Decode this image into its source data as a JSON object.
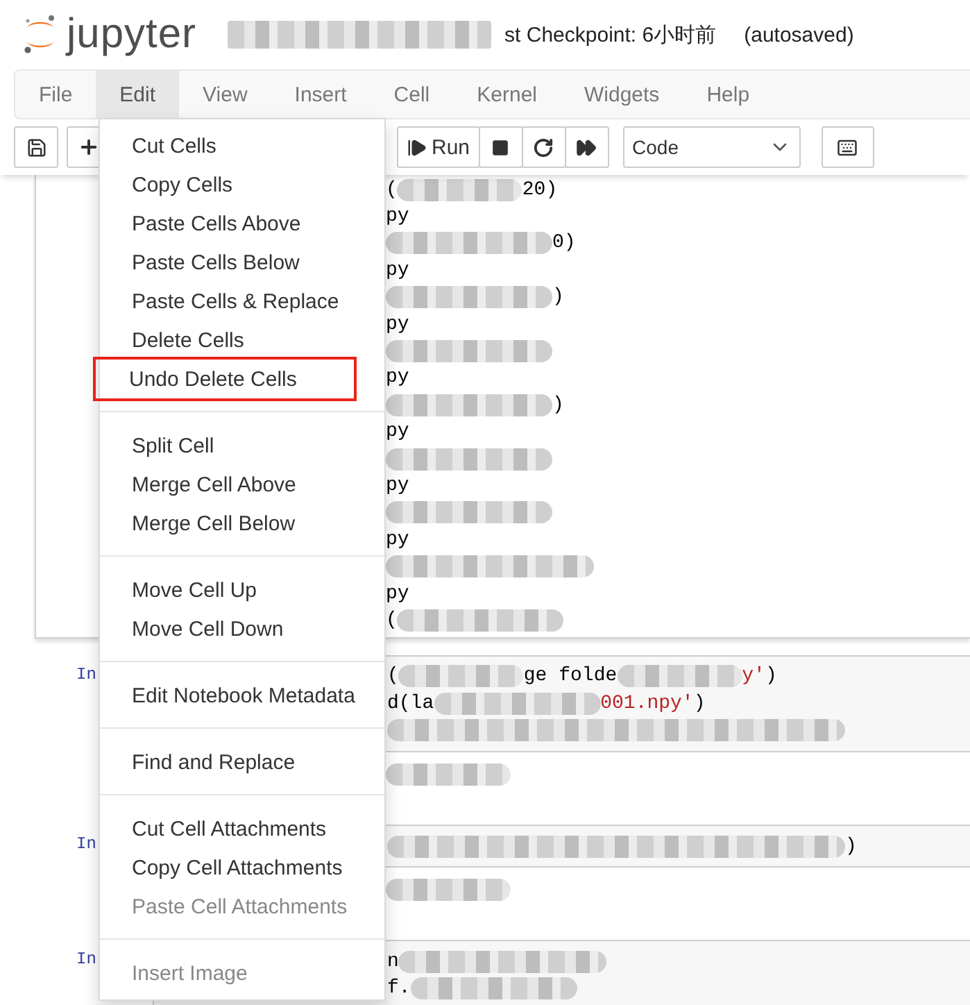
{
  "header": {
    "logo_text": "jupyter",
    "checkpoint": "st Checkpoint: 6小时前",
    "autosave": "(autosaved)"
  },
  "menubar": [
    {
      "label": "File",
      "selected": false
    },
    {
      "label": "Edit",
      "selected": true
    },
    {
      "label": "View",
      "selected": false
    },
    {
      "label": "Insert",
      "selected": false
    },
    {
      "label": "Cell",
      "selected": false
    },
    {
      "label": "Kernel",
      "selected": false
    },
    {
      "label": "Widgets",
      "selected": false
    },
    {
      "label": "Help",
      "selected": false
    }
  ],
  "toolbar": {
    "run_label": "Run",
    "cell_type": "Code"
  },
  "edit_menu": [
    [
      {
        "label": "Cut Cells",
        "disabled": false,
        "highlighted": false
      },
      {
        "label": "Copy Cells",
        "disabled": false,
        "highlighted": false
      },
      {
        "label": "Paste Cells Above",
        "disabled": false,
        "highlighted": false
      },
      {
        "label": "Paste Cells Below",
        "disabled": false,
        "highlighted": false
      },
      {
        "label": "Paste Cells & Replace",
        "disabled": false,
        "highlighted": false
      },
      {
        "label": "Delete Cells",
        "disabled": false,
        "highlighted": false
      },
      {
        "label": "Undo Delete Cells",
        "disabled": false,
        "highlighted": true
      }
    ],
    [
      {
        "label": "Split Cell",
        "disabled": false,
        "highlighted": false
      },
      {
        "label": "Merge Cell Above",
        "disabled": false,
        "highlighted": false
      },
      {
        "label": "Merge Cell Below",
        "disabled": false,
        "highlighted": false
      }
    ],
    [
      {
        "label": "Move Cell Up",
        "disabled": false,
        "highlighted": false
      },
      {
        "label": "Move Cell Down",
        "disabled": false,
        "highlighted": false
      }
    ],
    [
      {
        "label": "Edit Notebook Metadata",
        "disabled": false,
        "highlighted": false
      }
    ],
    [
      {
        "label": "Find and Replace",
        "disabled": false,
        "highlighted": false
      }
    ],
    [
      {
        "label": "Cut Cell Attachments",
        "disabled": false,
        "highlighted": false
      },
      {
        "label": "Copy Cell Attachments",
        "disabled": false,
        "highlighted": false
      },
      {
        "label": "Paste Cell Attachments",
        "disabled": true,
        "highlighted": false
      }
    ],
    [
      {
        "label": "Insert Image",
        "disabled": true,
        "highlighted": false
      }
    ]
  ],
  "output_lines": [
    [
      {
        "kind": "text",
        "text": "("
      },
      {
        "kind": "blur_medium"
      },
      {
        "kind": "text",
        "text": "20)"
      }
    ],
    [
      {
        "kind": "text",
        "text": "py"
      }
    ],
    [
      {
        "kind": "blur_long"
      },
      {
        "kind": "text",
        "text": "0)"
      }
    ],
    [
      {
        "kind": "text",
        "text": "py"
      }
    ],
    [
      {
        "kind": "blur_long"
      },
      {
        "kind": "text",
        "text": ")"
      }
    ],
    [
      {
        "kind": "text",
        "text": "py"
      }
    ],
    [
      {
        "kind": "blur_long"
      }
    ],
    [
      {
        "kind": "text",
        "text": "py"
      }
    ],
    [
      {
        "kind": "blur_long"
      },
      {
        "kind": "text",
        "text": ")"
      }
    ],
    [
      {
        "kind": "text",
        "text": "py"
      }
    ],
    [
      {
        "kind": "blur_long"
      }
    ],
    [
      {
        "kind": "text",
        "text": "py"
      }
    ],
    [
      {
        "kind": "blur_long"
      }
    ],
    [
      {
        "kind": "text",
        "text": "py"
      }
    ],
    [
      {
        "kind": "blur_xlong"
      }
    ],
    [
      {
        "kind": "text",
        "text": "py"
      }
    ],
    [
      {
        "kind": "text",
        "text": "("
      },
      {
        "kind": "blur_long"
      }
    ]
  ],
  "cells": [
    {
      "prompt": "In",
      "input": [
        [
          {
            "kind": "text",
            "text": "("
          },
          {
            "kind": "blur_medium"
          },
          {
            "kind": "text",
            "text": "ge folde"
          },
          {
            "kind": "blur_medium"
          },
          {
            "kind": "string",
            "text": "y'"
          },
          {
            "kind": "text",
            "text": ")"
          }
        ],
        [
          {
            "kind": "text",
            "text": "d(la"
          },
          {
            "kind": "blur_long"
          },
          {
            "kind": "string",
            "text": "001.npy'"
          },
          {
            "kind": "text",
            "text": ")"
          }
        ],
        [
          {
            "kind": "blur_huge"
          }
        ]
      ],
      "output": [
        [
          {
            "kind": "blur_medium"
          }
        ]
      ]
    },
    {
      "prompt": "In",
      "input": [
        [
          {
            "kind": "blur_huge"
          },
          {
            "kind": "text",
            "text": ")"
          }
        ]
      ],
      "output": [
        [
          {
            "kind": "blur_medium"
          }
        ]
      ]
    },
    {
      "prompt": "In",
      "input": [
        [
          {
            "kind": "text",
            "text": "n"
          },
          {
            "kind": "blur_xlong"
          }
        ],
        [
          {
            "kind": "text",
            "text": "f."
          },
          {
            "kind": "blur_long"
          }
        ]
      ]
    }
  ]
}
